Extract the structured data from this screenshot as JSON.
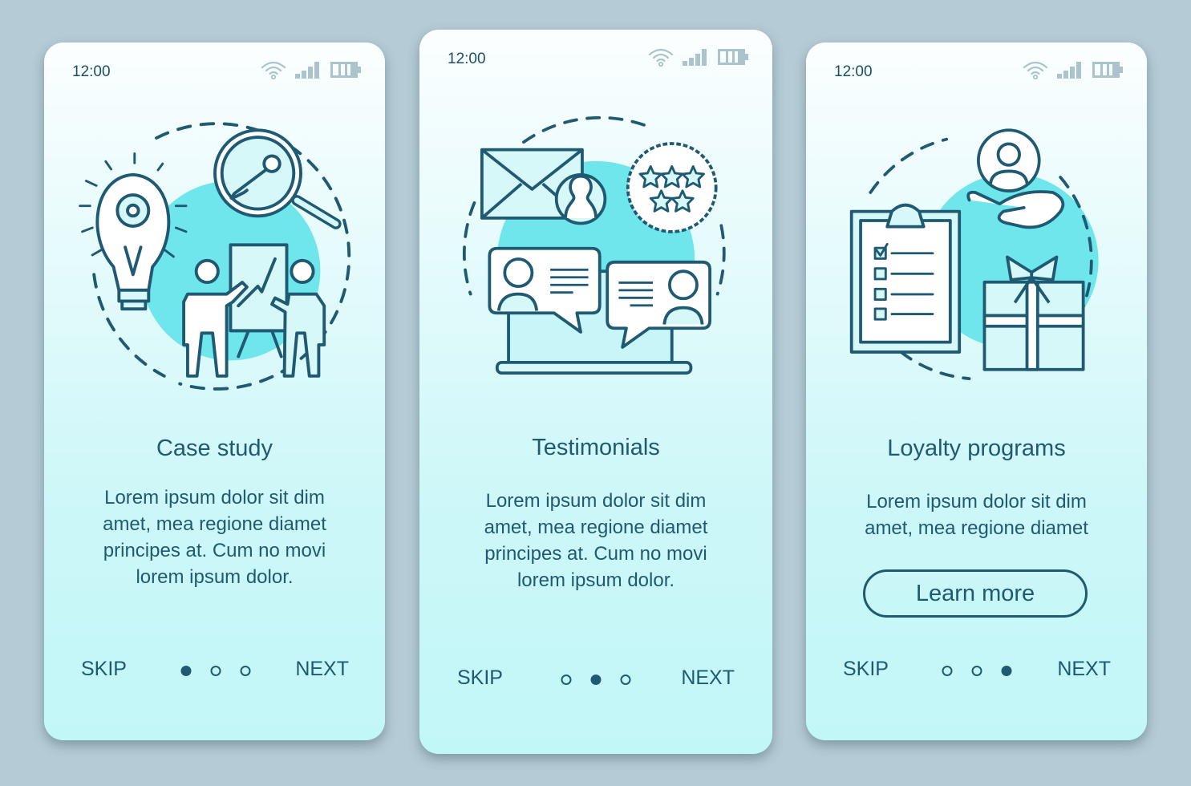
{
  "colors": {
    "background": "#b5cbd5",
    "accent": "#1f5a72",
    "blob": "#6ee6ec",
    "status_icon": "#aac3cd"
  },
  "screens": [
    {
      "status": {
        "time": "12:00",
        "icons": [
          "wifi-icon",
          "signal-icon",
          "battery-icon"
        ]
      },
      "illustration": "case-study-illustration",
      "title": "Case study",
      "body_lines": [
        "Lorem ipsum dolor sit dim",
        "amet, mea regione diamet",
        "principes at. Cum no movi",
        "lorem ipsum dolor."
      ],
      "skip_label": "SKIP",
      "next_label": "NEXT",
      "page_index": 1,
      "page_count": 3
    },
    {
      "status": {
        "time": "12:00",
        "icons": [
          "wifi-icon",
          "signal-icon",
          "battery-icon"
        ]
      },
      "illustration": "testimonials-illustration",
      "title": "Testimonials",
      "body_lines": [
        "Lorem ipsum dolor sit dim",
        "amet, mea regione diamet",
        "principes at. Cum no movi",
        "lorem ipsum dolor."
      ],
      "skip_label": "SKIP",
      "next_label": "NEXT",
      "page_index": 2,
      "page_count": 3
    },
    {
      "status": {
        "time": "12:00",
        "icons": [
          "wifi-icon",
          "signal-icon",
          "battery-icon"
        ]
      },
      "illustration": "loyalty-programs-illustration",
      "title": "Loyalty programs",
      "body_lines": [
        "Lorem ipsum dolor sit dim",
        "amet, mea regione diamet"
      ],
      "button_label": "Learn more",
      "skip_label": "SKIP",
      "next_label": "NEXT",
      "page_index": 3,
      "page_count": 3
    }
  ]
}
